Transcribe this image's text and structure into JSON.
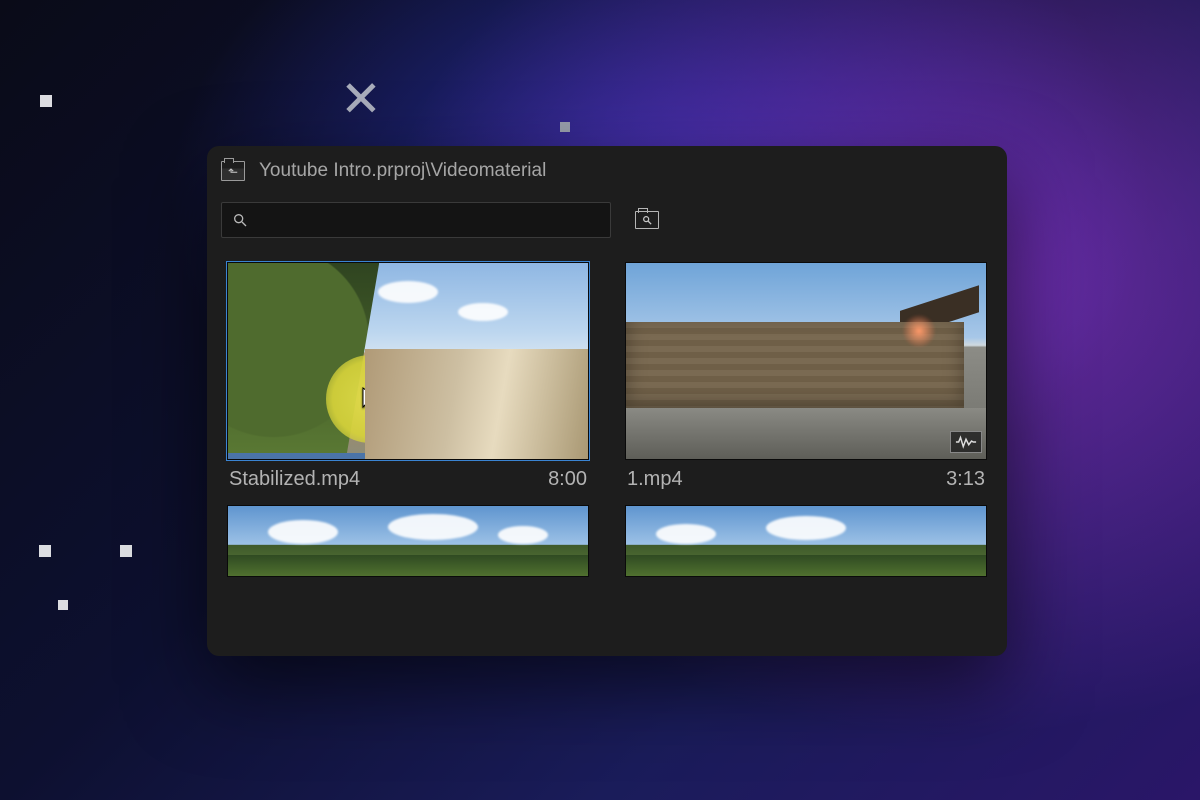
{
  "header": {
    "breadcrumb": "Youtube Intro.prproj\\Videomaterial"
  },
  "search": {
    "value": "",
    "placeholder": ""
  },
  "icons": {
    "up": "folder-up-icon",
    "search": "search-icon",
    "new_bin": "new-search-bin-icon",
    "audio_badge": "audio-waveform-icon",
    "cursor": "cursor-icon"
  },
  "clips": [
    {
      "name": "Stabilized.mp4",
      "duration": "8:00",
      "selected": true,
      "has_audio": true
    },
    {
      "name": "1.mp4",
      "duration": "3:13",
      "selected": false,
      "has_audio": true
    },
    {
      "name": "",
      "duration": "",
      "selected": false,
      "has_audio": false
    },
    {
      "name": "",
      "duration": "",
      "selected": false,
      "has_audio": false
    }
  ],
  "colors": {
    "panel_bg": "#1d1d1d",
    "text": "#a6a6a6",
    "scrub_bar": "#4b74a8",
    "highlight": "#e4e04a"
  }
}
